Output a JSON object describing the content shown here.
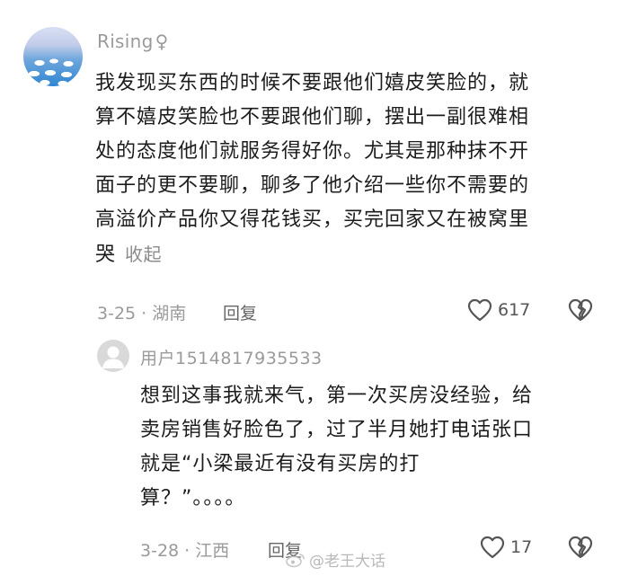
{
  "comment": {
    "username": "Rising",
    "gender_symbol": "♀",
    "lines": [
      "我发现买东西的时候不要跟他们嬉皮笑脸的，就",
      "算不嬉皮笑脸也不要跟他们聊，摆出一副很难相",
      "处的态度他们就服务得好你。尤其是那种抹不开",
      "面子的更不要聊，聊多了他介绍一些你不需要的",
      "高溢价产品你又得花钱买，买完回家又在被窝里",
      "哭"
    ],
    "collapse_label": "收起",
    "meta": "3-25 · 湖南",
    "reply_label": "回复",
    "like_count": "617",
    "icons": {
      "like": "heart-outline-icon",
      "dislike": "broken-heart-icon"
    }
  },
  "reply": {
    "username": "用户1514817935533",
    "lines": [
      "想到这事我就来气，第一次买房没经验，给",
      "卖房销售好脸色了，过了半月她打电话张口",
      "就是“小梁最近有没有买房的打",
      "算？”。。。。"
    ],
    "meta": "3-28 · 江西",
    "reply_label": "回复",
    "like_count": "17"
  },
  "watermark": {
    "text": "@老王大话"
  },
  "colors": {
    "text": "#1c1c1c",
    "muted": "#9a9a9a",
    "background": "#ffffff"
  }
}
